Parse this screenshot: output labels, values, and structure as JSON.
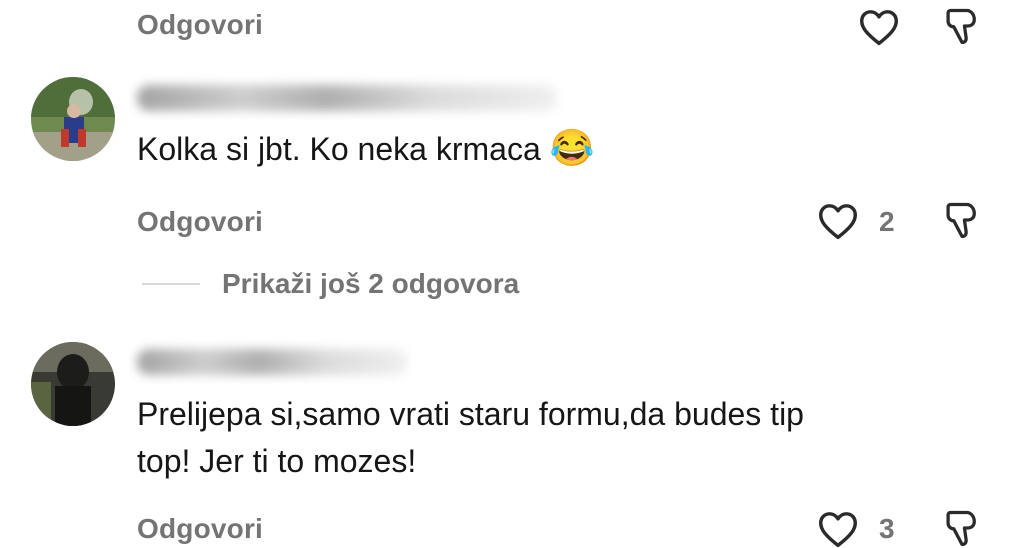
{
  "comments": [
    {
      "reply_label": "Odgovori",
      "likes": ""
    },
    {
      "text": "Kolka si jbt. Ko neka krmaca",
      "emoji": "😂",
      "reply_label": "Odgovori",
      "likes": "2",
      "more_replies": "Prikaži još 2 odgovora"
    },
    {
      "text_line1": "Prelijepa si,samo vrati staru formu,da budes tip",
      "text_line2": "top!  Jer ti to mozes!",
      "reply_label": "Odgovori",
      "likes": "3"
    }
  ],
  "icons": {
    "like": "heart-icon",
    "dislike": "thumbs-down-icon"
  },
  "colors": {
    "meta_text": "#747474",
    "body_text": "#161616",
    "icon_stroke": "#2b2b2b"
  }
}
